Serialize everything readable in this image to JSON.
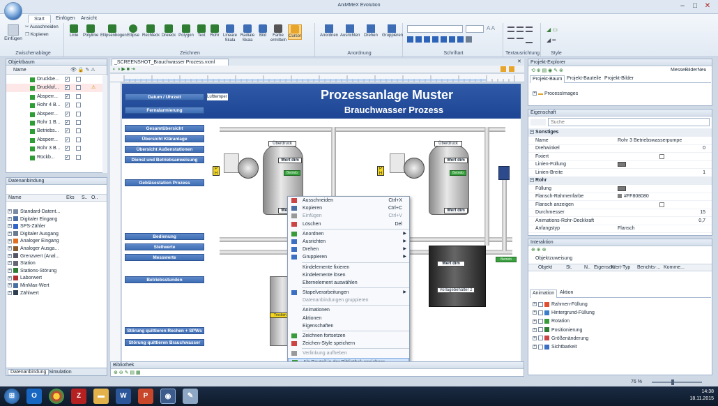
{
  "app": {
    "title": "AniMMeX Evolution"
  },
  "ribbon": {
    "tabs": [
      "Start",
      "Einfügen",
      "Ansicht"
    ],
    "clipboard": {
      "paste": "Einfügen",
      "cut": "Ausschneiden",
      "copy": "Kopieren",
      "group": "Zwischenablage"
    },
    "draw": {
      "items": [
        "Linie",
        "Polylinie",
        "Ellipsenbogen",
        "Ellipse",
        "Rechteck",
        "Dreieck",
        "Polygon",
        "Text",
        "Rohr",
        "Lineare Skala",
        "Radiale Skala",
        "Bild",
        "Farbe ermitteln",
        "Cursor"
      ],
      "group": "Zeichnen"
    },
    "arrange": {
      "items": [
        "Anordnen",
        "Ausrichten",
        "Drehen",
        "Gruppieren"
      ],
      "group": "Anordnung"
    },
    "font": {
      "group": "Schriftart"
    },
    "textalign": {
      "group": "Textausrichtung"
    },
    "style": {
      "group": "Style"
    }
  },
  "objektbaum": {
    "title": "Objektbaum",
    "col_name": "Name",
    "items": [
      "Druckbe...",
      "Druckluf...",
      "Absperr...",
      "Rohr 4 B...",
      "Absperr...",
      "Rohr 1 B...",
      "Betriebs...",
      "Absperr...",
      "Rohr 3 B...",
      "Rückb..."
    ]
  },
  "datenanbindung": {
    "title": "Datenanbindung",
    "cols": [
      "Name",
      "Eks",
      "S..",
      "O.."
    ],
    "items": [
      "Standard-Datent...",
      "Digitaler Eingang",
      "SPS-Zähler",
      "Digitaler Ausgang",
      "Analoger Eingang",
      "Analoger Ausga...",
      "Grenzwert (Anal...",
      "Station",
      "Stations-Störung",
      "Laborwert",
      "MinMax-Wert",
      "Zählwert"
    ],
    "tabs": [
      "Datenanbindung",
      "Simulation"
    ]
  },
  "document": {
    "tab": "_SCREENSHOT_Brauchwasser Prozess.vxml"
  },
  "canvas": {
    "title": "Prozessanlage Muster",
    "subtitle": "Brauchwasser Prozess",
    "nav": [
      "Datum / Uhrzeit",
      "Fernalarmierung",
      "Gesamtübersicht",
      "Übersicht Kläranlage",
      "Übersicht Außenstationen",
      "Dienst und Betriebsanweisung",
      "Gebläsestation Prozess",
      "Bedienung",
      "Stellwerte",
      "Messwerte",
      "Betriebsstunden",
      "Störung quittieren Rechen + SPWs",
      "Störung quittieren Brauchwasser"
    ],
    "temp_label": "Lufttemper",
    "tank_top_label": "Überdruck",
    "wert_label": "Wert dim",
    "status_label": "Betrieb",
    "vorlage_label": "Vorlagebehälter 2",
    "trocken_label": "Trocken",
    "side_status": "Betrieb"
  },
  "context_menu": {
    "items": [
      {
        "label": "Ausschneiden",
        "shortcut": "Ctrl+X"
      },
      {
        "label": "Kopieren",
        "shortcut": "Ctrl+C"
      },
      {
        "label": "Einfügen",
        "shortcut": "Ctrl+V",
        "disabled": true
      },
      {
        "label": "Löschen",
        "shortcut": "Del"
      },
      {
        "label": "Anordnen",
        "submenu": true
      },
      {
        "label": "Ausrichten",
        "submenu": true
      },
      {
        "label": "Drehen",
        "submenu": true
      },
      {
        "label": "Gruppieren",
        "submenu": true
      },
      {
        "label": "Kindelemente fixieren"
      },
      {
        "label": "Kindelemente lösen"
      },
      {
        "label": "Elternelement auswählen"
      },
      {
        "label": "Stapelverarbeitungen",
        "submenu": true
      },
      {
        "label": "Datenanbindungen gruppieren",
        "disabled": true
      },
      {
        "label": "Animationen"
      },
      {
        "label": "Aktionen"
      },
      {
        "label": "Eigenschaften"
      },
      {
        "label": "Zeichnen fortsetzen"
      },
      {
        "label": "Zeichen-Style speichern"
      },
      {
        "label": "Verlinkung aufheben",
        "disabled": true
      },
      {
        "label": "Als Bauteil in der Bibliothek speichern",
        "highlighted": true
      }
    ]
  },
  "bibliothek": {
    "title": "Bibliothek"
  },
  "projekt_explorer": {
    "title": "Projekt-Explorer",
    "link": "MesseBilderNeu",
    "tabs": [
      "Projekt-Baum",
      "Projekt-Bauteile",
      "Projekt-Bilder"
    ],
    "tree_item": "ProcessImages"
  },
  "eigenschaft": {
    "title": "Eigenschaft",
    "search_placeholder": "Suche",
    "sections": [
      "Sonstiges",
      "Rohr"
    ],
    "rows_a": [
      {
        "k": "Name",
        "v": "Rohr 3 Betriebswasserpumpe"
      },
      {
        "k": "Drehwinkel",
        "v": "0"
      },
      {
        "k": "Fixiert",
        "v": ""
      },
      {
        "k": "Linien-Füllung",
        "v": ""
      },
      {
        "k": "Linien-Breite",
        "v": "1"
      }
    ],
    "rows_b": [
      {
        "k": "Füllung",
        "v": ""
      },
      {
        "k": "Flansch-Rahmenfarbe",
        "v": "#FF808080"
      },
      {
        "k": "Flansch anzeigen",
        "v": ""
      },
      {
        "k": "Durchmesser",
        "v": "15"
      },
      {
        "k": "Animations-Rohr-Deckkraft",
        "v": "0,7"
      },
      {
        "k": "Anfangstyp",
        "v": "Flansch"
      }
    ]
  },
  "interaktion": {
    "title": "Interaktion",
    "assign": "Objektzuweisung",
    "cols": [
      "Objekt",
      "St.",
      "N..",
      "Eigensch...",
      "Wert-Typ",
      "Berichts-...",
      "Komme..."
    ],
    "tabs": [
      "Animation",
      "Aktion"
    ],
    "animations": [
      "Rahmen-Füllung",
      "Hintergrund-Füllung",
      "Rotation",
      "Positionierung",
      "Größenänderung",
      "Sichtbarkeit"
    ]
  },
  "statusbar": {
    "zoom": "76 %"
  },
  "taskbar": {
    "time": "14:38",
    "date": "18.11.2015"
  }
}
